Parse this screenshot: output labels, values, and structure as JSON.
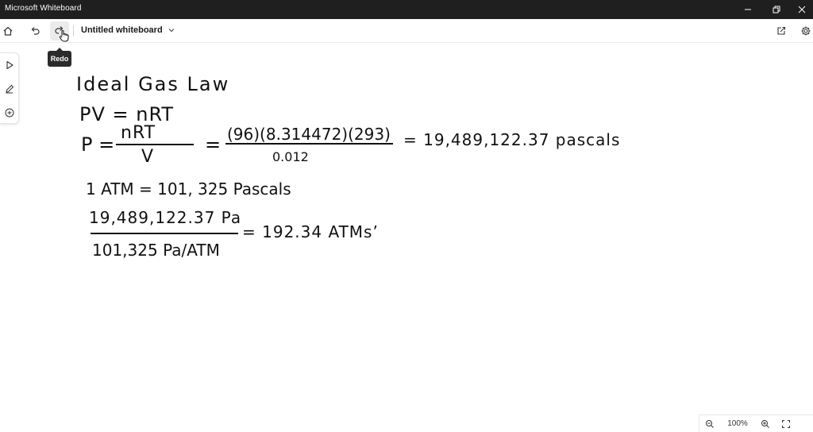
{
  "window": {
    "title": "Microsoft Whiteboard"
  },
  "toolbar": {
    "document_title": "Untitled whiteboard",
    "tooltip": "Redo"
  },
  "whiteboard": {
    "heading": "Ideal Gas Law",
    "eq1": "PV = nRT",
    "eq2_lhs": "P =",
    "eq2_frac1_num": "nRT",
    "eq2_frac1_den": "V",
    "eq2_equals": "=",
    "eq2_frac2_num": "(96)(8.314472)(293)",
    "eq2_frac2_den": "0.012",
    "eq2_result": "= 19,489,122.37 pascals",
    "eq3": "1 ATM = 101, 325 Pascals",
    "eq4_num": "19,489,122.37 Pa",
    "eq4_den": "101,325 Pa/ATM",
    "eq4_result": "= 192.34 ATMs’"
  },
  "zoom": {
    "level": "100%"
  }
}
